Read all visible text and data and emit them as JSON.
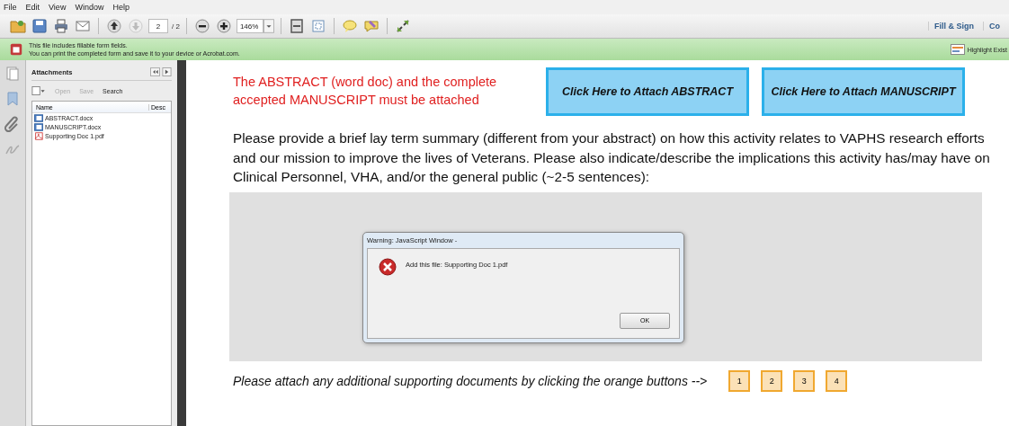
{
  "menu_bar": [
    "File",
    "Edit",
    "View",
    "Window",
    "Help"
  ],
  "toolbar": {
    "page_field": "2",
    "page_total": "/ 2",
    "zoom_field": "146%",
    "right_links": [
      "Fill & Sign",
      "Co"
    ]
  },
  "info_bar": {
    "lines": [
      "This file includes fillable form fields.",
      "You can print the completed form and save it to your device or Acrobat.com."
    ],
    "button": "Highlight Exist"
  },
  "attachments_panel": {
    "title": "Attachments",
    "tools": [
      "Open",
      "Save",
      "Search"
    ],
    "columns": [
      "Name",
      "Desc"
    ],
    "files": [
      {
        "name": "ABSTRACT.docx",
        "kind": "doc"
      },
      {
        "name": "MANUSCRIPT.docx",
        "kind": "doc"
      },
      {
        "name": "Supporting Doc 1.pdf",
        "kind": "pdf"
      }
    ]
  },
  "page": {
    "notice": "The ABSTRACT (word doc) and the complete accepted MANUSCRIPT must be attached",
    "attach_buttons": [
      "Click Here to Attach ABSTRACT",
      "Click Here to Attach MANUSCRIPT"
    ],
    "summary_prompt": "Please provide a brief lay term summary (different from your abstract) on how this activity relates to VAPHS research efforts and our mission to improve the lives of Veterans. Please also indicate/describe the implications this activity has/may have on Clinical Personnel, VHA, and/or the general public (~2-5 sentences):",
    "dialog": {
      "title": "Warning: JavaScript Window -",
      "message": "Add this file: Supporting Doc 1.pdf",
      "button": "OK"
    },
    "supporting_prompt": "Please attach any additional supporting documents by clicking the orange buttons -->",
    "supporting_buttons": [
      "1",
      "2",
      "3",
      "4"
    ]
  }
}
